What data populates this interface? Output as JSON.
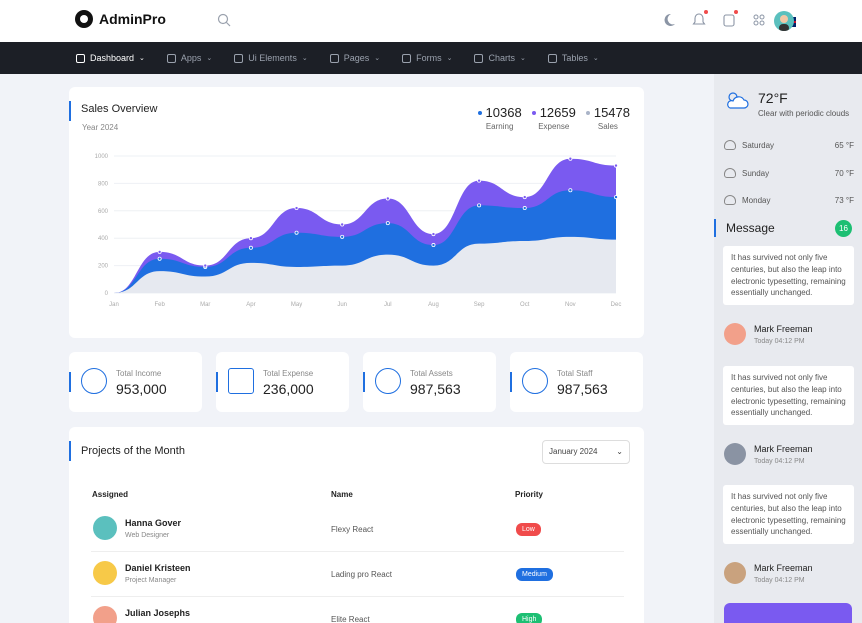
{
  "brand": {
    "name": "AdminPro"
  },
  "nav": [
    {
      "label": "Dashboard",
      "active": true
    },
    {
      "label": "Apps"
    },
    {
      "label": "Ui Elements"
    },
    {
      "label": "Pages"
    },
    {
      "label": "Forms"
    },
    {
      "label": "Charts"
    },
    {
      "label": "Tables"
    }
  ],
  "sales": {
    "title": "Sales Overview",
    "subtitle": "Year 2024",
    "legend": [
      {
        "value": "10368",
        "label": "Earning",
        "color": "#1f6fe0"
      },
      {
        "value": "12659",
        "label": "Expense",
        "color": "#7a5af0"
      },
      {
        "value": "15478",
        "label": "Sales",
        "color": "#aab4c8"
      }
    ]
  },
  "chart_data": {
    "type": "area",
    "categories": [
      "Jan",
      "Feb",
      "Mar",
      "Apr",
      "May",
      "Jun",
      "Jul",
      "Aug",
      "Sep",
      "Oct",
      "Nov",
      "Dec"
    ],
    "ylim": [
      0,
      1000
    ],
    "yticks": [
      0,
      200,
      400,
      600,
      800,
      1000
    ],
    "series": [
      {
        "name": "Sales",
        "color": "#e6e9f0",
        "values": [
          0,
          160,
          120,
          220,
          190,
          200,
          280,
          200,
          360,
          380,
          410,
          390
        ]
      },
      {
        "name": "Earning",
        "color": "#1f6fe0",
        "values": [
          0,
          250,
          190,
          330,
          440,
          410,
          510,
          350,
          640,
          620,
          750,
          700
        ]
      },
      {
        "name": "Expense",
        "color": "#7a5af0",
        "values": [
          0,
          300,
          200,
          400,
          620,
          500,
          690,
          430,
          820,
          700,
          980,
          930
        ]
      }
    ]
  },
  "stats": [
    {
      "label": "Total Income",
      "value": "953,000"
    },
    {
      "label": "Total Expense",
      "value": "236,000"
    },
    {
      "label": "Total Assets",
      "value": "987,563"
    },
    {
      "label": "Total Staff",
      "value": "987,563"
    }
  ],
  "projects": {
    "title": "Projects of the Month",
    "month": "January 2024",
    "headers": {
      "assigned": "Assigned",
      "name": "Name",
      "priority": "Priority"
    },
    "rows": [
      {
        "name": "Hanna Gover",
        "role": "Web Designer",
        "project": "Flexy React",
        "priority": "Low",
        "priority_color": "#f04b4b",
        "avatar_color": "#5bc0be"
      },
      {
        "name": "Daniel Kristeen",
        "role": "Project Manager",
        "project": "Lading pro React",
        "priority": "Medium",
        "priority_color": "#1f6fe0",
        "avatar_color": "#f7c948"
      },
      {
        "name": "Julian Josephs",
        "role": "",
        "project": "Elite React",
        "priority": "High",
        "priority_color": "#1dbf73",
        "avatar_color": "#f2a08a"
      }
    ]
  },
  "weather": {
    "temp": "72°F",
    "desc": "Clear with periodic clouds",
    "forecast": [
      {
        "day": "Saturday",
        "temp": "65 °F"
      },
      {
        "day": "Sunday",
        "temp": "70 °F"
      },
      {
        "day": "Monday",
        "temp": "73 °F"
      }
    ]
  },
  "messages": {
    "title": "Message",
    "count": "16",
    "items": [
      {
        "text": "It has survived not only five centuries, but also the leap into electronic typesetting, remaining essentially unchanged.",
        "sender": "Mark Freeman",
        "time": "Today 04:12 PM",
        "avatar_color": "#f2a08a"
      },
      {
        "text": "It has survived not only five centuries, but also the leap into electronic typesetting, remaining essentially unchanged.",
        "sender": "Mark Freeman",
        "time": "Today 04:12 PM",
        "avatar_color": "#8a93a3"
      },
      {
        "text": "It has survived not only five centuries, but also the leap into electronic typesetting, remaining essentially unchanged.",
        "sender": "Mark Freeman",
        "time": "Today 04:12 PM",
        "avatar_color": "#c9a27e"
      }
    ]
  }
}
